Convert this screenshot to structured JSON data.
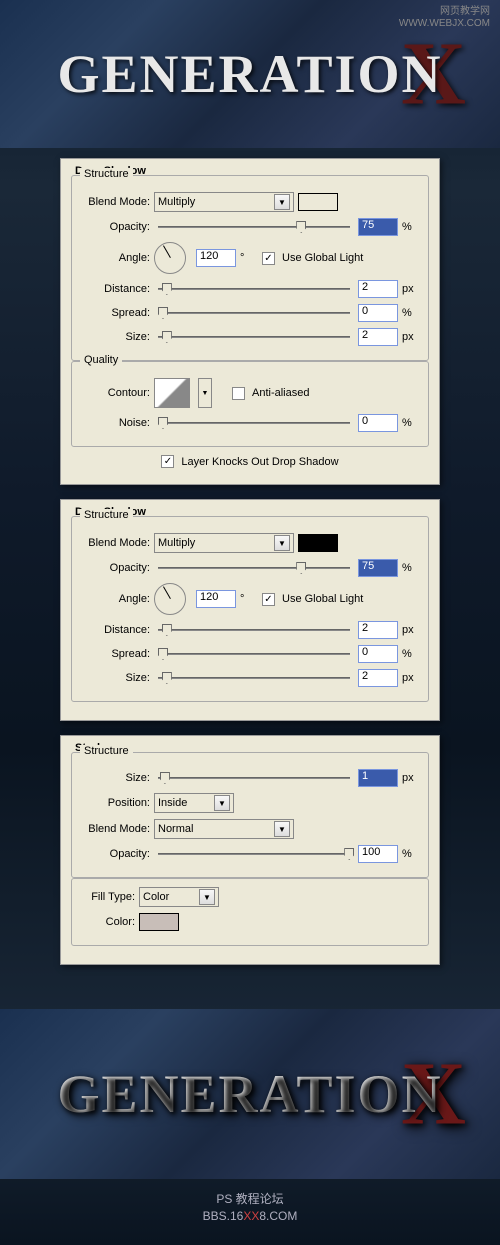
{
  "watermark": {
    "line1": "网页教学网",
    "line2": "WWW.WEBJX.COM"
  },
  "hero": {
    "text": "GENERATION",
    "x": "X"
  },
  "labels": {
    "drop_shadow": "Drop Shadow",
    "stroke": "Stroke",
    "structure": "Structure",
    "quality": "Quality",
    "blend_mode": "Blend Mode:",
    "opacity": "Opacity:",
    "angle": "Angle:",
    "distance": "Distance:",
    "spread": "Spread:",
    "size": "Size:",
    "contour": "Contour:",
    "noise": "Noise:",
    "position": "Position:",
    "fill_type": "Fill Type:",
    "color": "Color:",
    "use_global": "Use Global Light",
    "anti_aliased": "Anti-aliased",
    "knockout": "Layer Knocks Out Drop Shadow"
  },
  "units": {
    "pct": "%",
    "px": "px",
    "deg": "°"
  },
  "panel1": {
    "blend_mode": "Multiply",
    "blend_color": "#000000",
    "opacity": "75",
    "angle": "120",
    "use_global": true,
    "distance": "2",
    "spread": "0",
    "size": "2",
    "anti_aliased": false,
    "noise": "0",
    "knockout": true
  },
  "panel2": {
    "blend_mode": "Multiply",
    "blend_color": "#000000",
    "opacity": "75",
    "angle": "120",
    "use_global": true,
    "distance": "2",
    "spread": "0",
    "size": "2"
  },
  "panel3": {
    "size": "1",
    "position": "Inside",
    "blend_mode": "Normal",
    "opacity": "100",
    "fill_type": "Color",
    "color": "#c8beb8"
  },
  "credits": {
    "line1": "PS 教程论坛",
    "line2a": "BBS.16",
    "line2b": "XX",
    "line2c": "8.COM"
  }
}
